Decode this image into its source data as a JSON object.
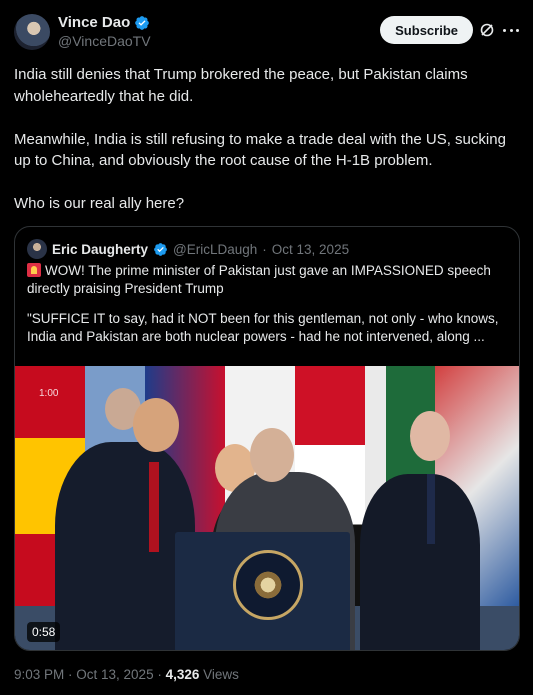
{
  "author": {
    "name": "Vince Dao",
    "handle": "@VinceDaoTV",
    "subscribe_label": "Subscribe"
  },
  "tweet": {
    "paragraphs": [
      "India still denies that Trump brokered the peace, but Pakistan claims wholeheartedly that he did.",
      "Meanwhile, India is still refusing to make a trade deal with the US, sucking up to China, and obviously the root cause of the H-1B problem.",
      "Who is our real ally here?"
    ]
  },
  "quote": {
    "name": "Eric Daugherty",
    "handle": "@EricLDaugh",
    "separator": "·",
    "date": "Oct 13, 2025",
    "line1": "WOW! The prime minister of Pakistan just gave an IMPASSIONED speech directly praising President Trump",
    "line2": "\"SUFFICE IT to say, had it NOT been for this gentleman, not only - who knows, India and Pakistan are both nuclear powers - had he not intervened, along ...",
    "video": {
      "duration": "0:58",
      "overlay_text": "1:00"
    }
  },
  "footer": {
    "time": "9:03 PM · Oct 13, 2025 · ",
    "views_count": "4,326",
    "views_label": " Views"
  },
  "colors": {
    "verified": "#1d9bf0",
    "muted": "#71767b",
    "text": "#e7e9ea"
  },
  "icons": [
    "verified-badge-icon",
    "grok-icon",
    "more-icon",
    "siren-emoji-icon"
  ]
}
